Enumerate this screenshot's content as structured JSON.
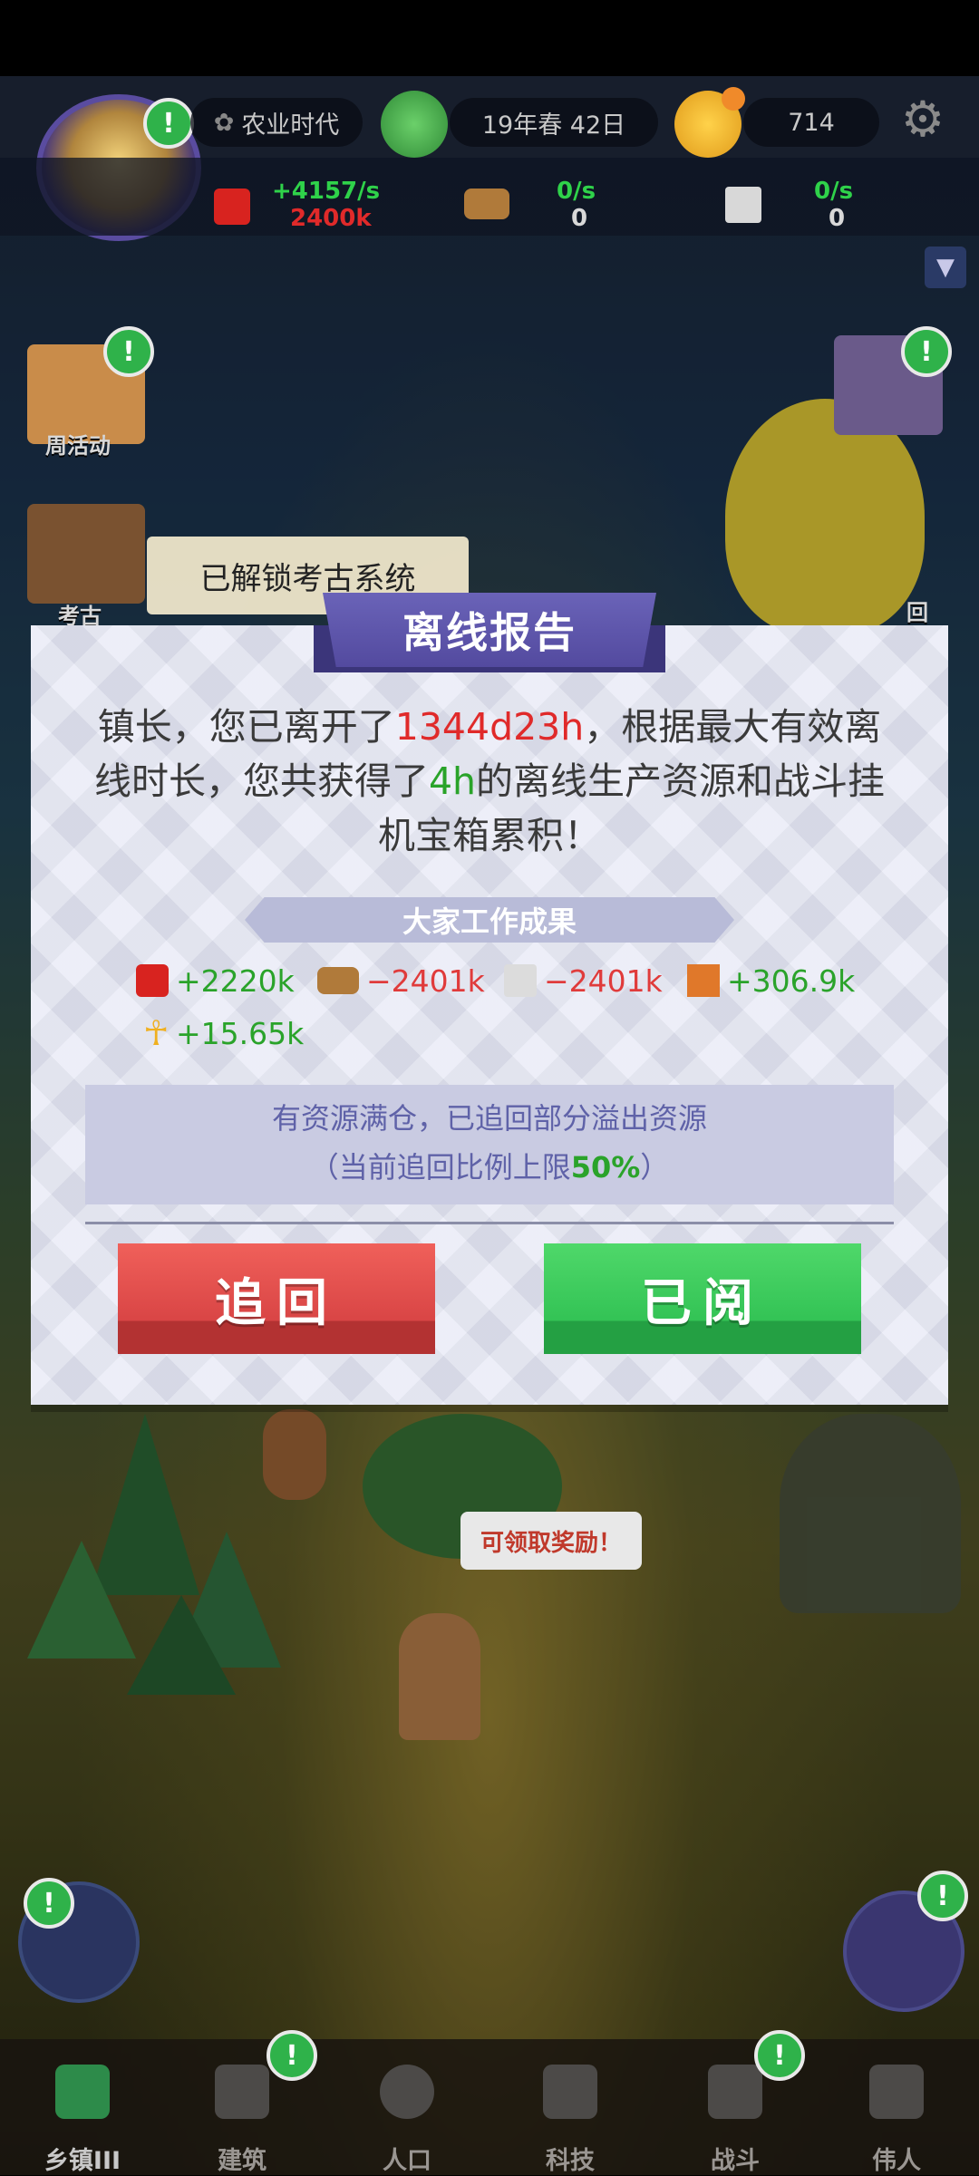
{
  "top_bar": {
    "era": "农业时代",
    "date": "19年春 42日",
    "currency": "714"
  },
  "resources_bar": [
    {
      "icon": "apple-icon",
      "rate": "+4157/s",
      "amount": "2400k",
      "rate_color": "#2fd24a",
      "amount_color": "#e02a2a"
    },
    {
      "icon": "wood-log-icon",
      "rate": "0/s",
      "amount": "0",
      "rate_color": "#2fd24a",
      "amount_color": "#d8d8d8"
    },
    {
      "icon": "stone-icon",
      "rate": "0/s",
      "amount": "0",
      "rate_color": "#2fd24a",
      "amount_color": "#d8d8d8"
    }
  ],
  "side": {
    "weekly_activity": "周活动",
    "archaeology": "考古",
    "right_partial": "回",
    "unlock_banner": "已解锁考古系统"
  },
  "dialog": {
    "title": "离线报告",
    "msg_part1": "镇长，您已离开了",
    "away_time": "1344d23h",
    "msg_part2": "，根据最大有效离线时长，您共获得了",
    "effective_time": "4h",
    "msg_part3": "的离线生产资源和战斗挂机宝箱累积！",
    "results_title": "大家工作成果",
    "results": [
      {
        "icon": "apple-icon",
        "value": "+2220k",
        "sign": "positive"
      },
      {
        "icon": "wood-log-icon",
        "value": "−2401k",
        "sign": "negative"
      },
      {
        "icon": "stone-icon",
        "value": "−2401k",
        "sign": "negative"
      },
      {
        "icon": "brick-icon",
        "value": "+306.9k",
        "sign": "positive"
      },
      {
        "icon": "ankh-icon",
        "value": "+15.65k",
        "sign": "positive"
      }
    ],
    "overflow_line1": "有资源满仓，已追回部分溢出资源",
    "overflow_line2_prefix": "（当前追回比例上限",
    "overflow_percent": "50%",
    "overflow_line2_suffix": "）",
    "recover_button": "追回",
    "read_button": "已阅"
  },
  "scene": {
    "speech_bubble": "可领取奖励！"
  },
  "bottom_nav": [
    {
      "label": "乡镇III",
      "icon": "town-icon",
      "active": true
    },
    {
      "label": "建筑",
      "icon": "house-icon",
      "active": false
    },
    {
      "label": "人口",
      "icon": "person-icon",
      "active": false
    },
    {
      "label": "科技",
      "icon": "book-icon",
      "active": false
    },
    {
      "label": "战斗",
      "icon": "crossed-swords-icon",
      "active": false
    },
    {
      "label": "伟人",
      "icon": "bust-icon",
      "active": false
    }
  ]
}
